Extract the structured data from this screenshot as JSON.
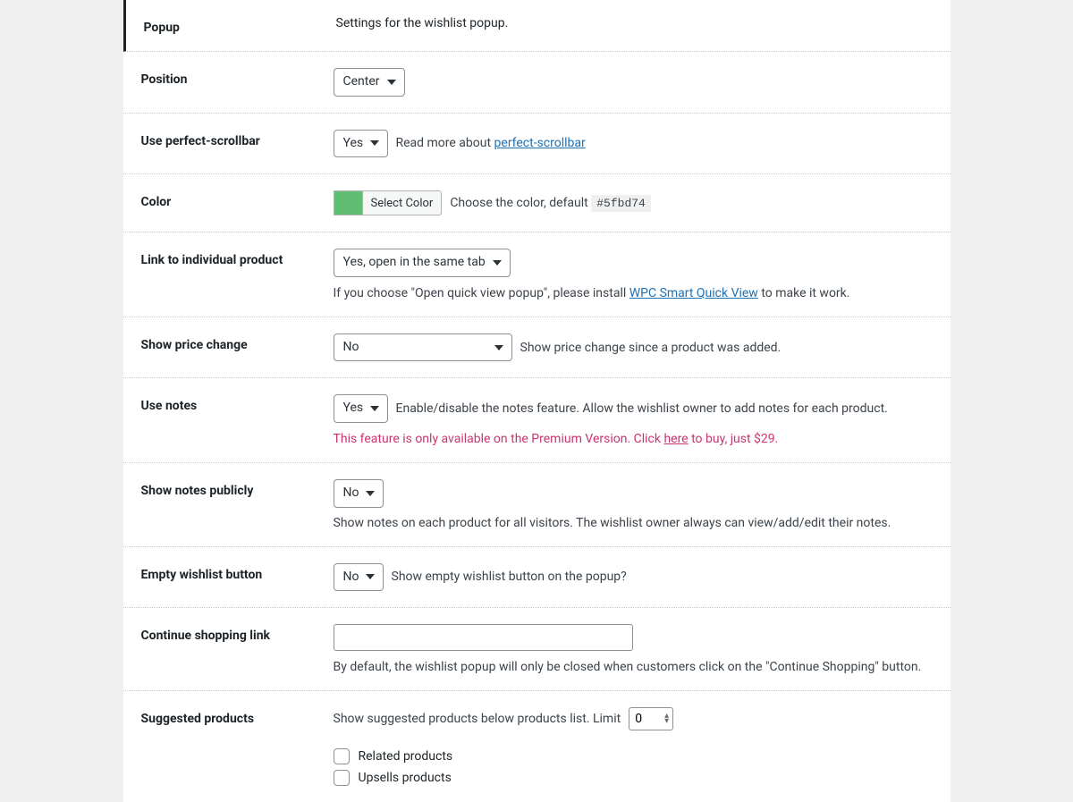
{
  "header": {
    "title": "Popup",
    "desc": "Settings for the wishlist popup."
  },
  "rows": {
    "position": {
      "label": "Position",
      "value": "Center"
    },
    "perfect_scrollbar": {
      "label": "Use perfect-scrollbar",
      "value": "Yes",
      "hint_prefix": "Read more about ",
      "hint_link": "perfect-scrollbar"
    },
    "color": {
      "label": "Color",
      "button": "Select Color",
      "hint_prefix": "Choose the color, default ",
      "code": "#5fbd74",
      "swatch": "#5fbd74"
    },
    "link_product": {
      "label": "Link to individual product",
      "value": "Yes, open in the same tab",
      "sub_prefix": "If you choose \"Open quick view popup\", please install ",
      "sub_link": "WPC Smart Quick View",
      "sub_suffix": " to make it work."
    },
    "price_change": {
      "label": "Show price change",
      "value": "No",
      "hint": "Show price change since a product was added."
    },
    "use_notes": {
      "label": "Use notes",
      "value": "Yes",
      "hint": "Enable/disable the notes feature. Allow the wishlist owner to add notes for each product.",
      "premium_prefix": "This feature is only available on the Premium Version. Click ",
      "premium_link": "here",
      "premium_suffix": " to buy, just $29."
    },
    "show_notes_publicly": {
      "label": "Show notes publicly",
      "value": "No",
      "hint": "Show notes on each product for all visitors. The wishlist owner always can view/add/edit their notes."
    },
    "empty_wishlist": {
      "label": "Empty wishlist button",
      "value": "No",
      "hint": "Show empty wishlist button on the popup?"
    },
    "continue_shopping": {
      "label": "Continue shopping link",
      "value": "",
      "sub": "By default, the wishlist popup will only be closed when customers click on the \"Continue Shopping\" button."
    },
    "suggested": {
      "label": "Suggested products",
      "hint": "Show suggested products below products list. Limit",
      "limit": "0",
      "cb_related": "Related products",
      "cb_upsells": "Upsells products"
    }
  }
}
